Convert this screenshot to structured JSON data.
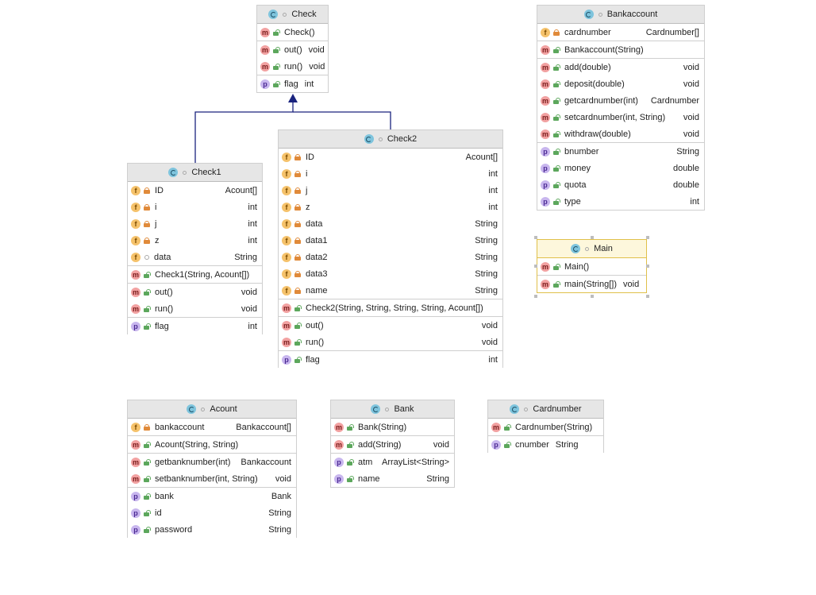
{
  "classes": {
    "check": {
      "title": "Check",
      "ctor": [
        "Check()"
      ],
      "methods": [
        [
          "out()",
          "void"
        ],
        [
          "run()",
          "void"
        ]
      ],
      "props": [
        [
          "flag",
          "int"
        ]
      ]
    },
    "check1": {
      "title": "Check1",
      "fields": [
        [
          "ID",
          "Acount[]"
        ],
        [
          "i",
          "int"
        ],
        [
          "j",
          "int"
        ],
        [
          "z",
          "int"
        ],
        [
          "data",
          "String"
        ]
      ],
      "ctor": [
        "Check1(String, Acount[])"
      ],
      "methods": [
        [
          "out()",
          "void"
        ],
        [
          "run()",
          "void"
        ]
      ],
      "props": [
        [
          "flag",
          "int"
        ]
      ]
    },
    "check2": {
      "title": "Check2",
      "fields": [
        [
          "ID",
          "Acount[]"
        ],
        [
          "i",
          "int"
        ],
        [
          "j",
          "int"
        ],
        [
          "z",
          "int"
        ],
        [
          "data",
          "String"
        ],
        [
          "data1",
          "String"
        ],
        [
          "data2",
          "String"
        ],
        [
          "data3",
          "String"
        ],
        [
          "name",
          "String"
        ]
      ],
      "ctor": [
        "Check2(String, String, String, String, Acount[])"
      ],
      "methods": [
        [
          "out()",
          "void"
        ],
        [
          "run()",
          "void"
        ]
      ],
      "props": [
        [
          "flag",
          "int"
        ]
      ]
    },
    "bankaccount": {
      "title": "Bankaccount",
      "fields": [
        [
          "cardnumber",
          "Cardnumber[]"
        ]
      ],
      "ctor": [
        "Bankaccount(String)"
      ],
      "methods": [
        [
          "add(double)",
          "void"
        ],
        [
          "deposit(double)",
          "void"
        ],
        [
          "getcardnumber(int)",
          "Cardnumber"
        ],
        [
          "setcardnumber(int, String)",
          "void"
        ],
        [
          "withdraw(double)",
          "void"
        ]
      ],
      "props": [
        [
          "bnumber",
          "String"
        ],
        [
          "money",
          "double"
        ],
        [
          "quota",
          "double"
        ],
        [
          "type",
          "int"
        ]
      ]
    },
    "main": {
      "title": "Main",
      "ctor": [
        "Main()"
      ],
      "methods": [
        [
          "main(String[])",
          "void"
        ]
      ]
    },
    "acount": {
      "title": "Acount",
      "fields": [
        [
          "bankaccount",
          "Bankaccount[]"
        ]
      ],
      "ctor": [
        "Acount(String, String)"
      ],
      "methods": [
        [
          "getbanknumber(int)",
          "Bankaccount"
        ],
        [
          "setbanknumber(int, String)",
          "void"
        ]
      ],
      "props": [
        [
          "bank",
          "Bank"
        ],
        [
          "id",
          "String"
        ],
        [
          "password",
          "String"
        ]
      ]
    },
    "bank": {
      "title": "Bank",
      "ctor": [
        "Bank(String)"
      ],
      "methods": [
        [
          "add(String)",
          "void"
        ]
      ],
      "props": [
        [
          "atm",
          "ArrayList<String>"
        ],
        [
          "name",
          "String"
        ]
      ]
    },
    "cardnumber": {
      "title": "Cardnumber",
      "ctor": [
        "Cardnumber(String)"
      ],
      "props": [
        [
          "cnumber",
          "String"
        ]
      ]
    }
  },
  "colors": {
    "edge": "#1a237e",
    "field_icon": "#f5c26b",
    "method_icon": "#f2a1a1",
    "property_icon": "#c8b6ee",
    "class_icon": "#7ec4dd",
    "selection": "#e0c04a"
  }
}
